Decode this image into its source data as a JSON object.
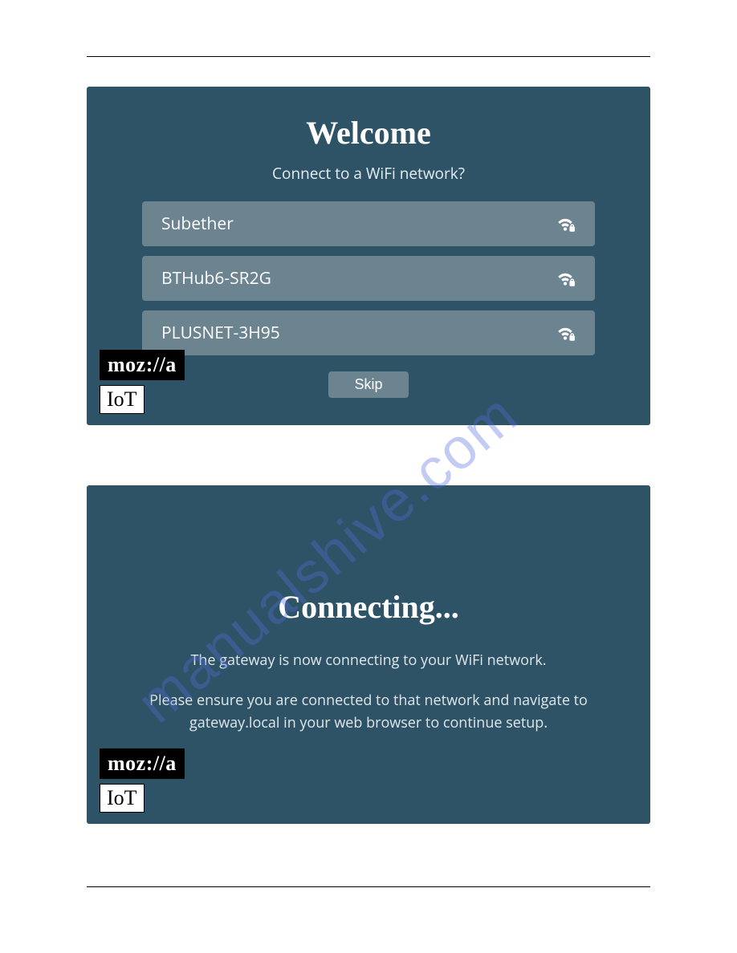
{
  "watermark": "manualshive.com",
  "panel1": {
    "title": "Welcome",
    "subtitle": "Connect to a WiFi network?",
    "networks": [
      {
        "ssid": "Subether",
        "secured": true
      },
      {
        "ssid": "BTHub6-SR2G",
        "secured": true
      },
      {
        "ssid": "PLUSNET-3H95",
        "secured": true
      }
    ],
    "skip_label": "Skip"
  },
  "brand": {
    "mozilla": "moz://a",
    "iot": "IoT"
  },
  "panel2": {
    "title": "Connecting...",
    "line1": "The gateway is now connecting to your WiFi network.",
    "line2": "Please ensure you are connected to that network and navigate to gateway.local in your web browser to continue setup."
  }
}
